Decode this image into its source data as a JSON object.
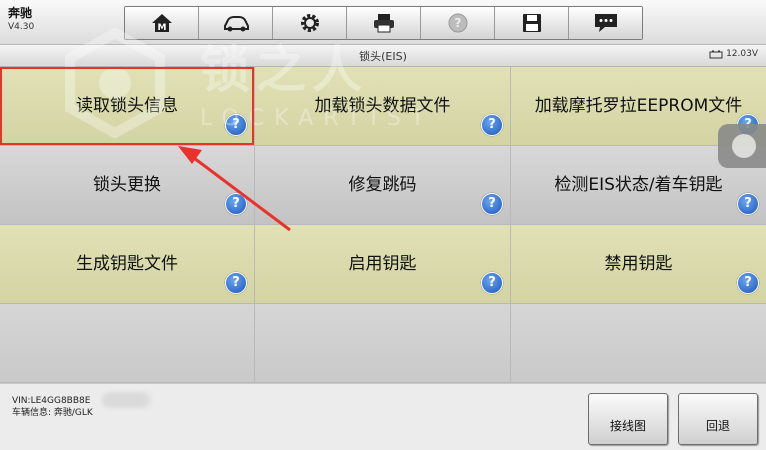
{
  "brand": {
    "name": "奔驰",
    "version": "V4.30"
  },
  "toolbar": [
    {
      "name": "home-icon"
    },
    {
      "name": "car-icon"
    },
    {
      "name": "gear-icon"
    },
    {
      "name": "printer-icon"
    },
    {
      "name": "help-icon"
    },
    {
      "name": "save-icon"
    },
    {
      "name": "message-icon"
    }
  ],
  "title": "锁头(EIS)",
  "battery": {
    "voltage": "12.03V"
  },
  "watermark": {
    "cn": "锁之人",
    "en": "LOCKARTIST"
  },
  "menu": [
    {
      "label": "读取锁头信息",
      "style": "y"
    },
    {
      "label": "加载锁头数据文件",
      "style": "y"
    },
    {
      "label": "加载摩托罗拉EEPROM文件",
      "style": "y"
    },
    {
      "label": "锁头更换",
      "style": "g"
    },
    {
      "label": "修复跳码",
      "style": "g"
    },
    {
      "label": "检测EIS状态/着车钥匙",
      "style": "g"
    },
    {
      "label": "生成钥匙文件",
      "style": "y"
    },
    {
      "label": "启用钥匙",
      "style": "y"
    },
    {
      "label": "禁用钥匙",
      "style": "y"
    }
  ],
  "help_symbol": "?",
  "vehicle": {
    "vin": "VIN:LE4GG8BB8E",
    "info": "车辆信息: 奔驰/GLK"
  },
  "buttons": {
    "wiring": "接线图",
    "back": "回退"
  }
}
